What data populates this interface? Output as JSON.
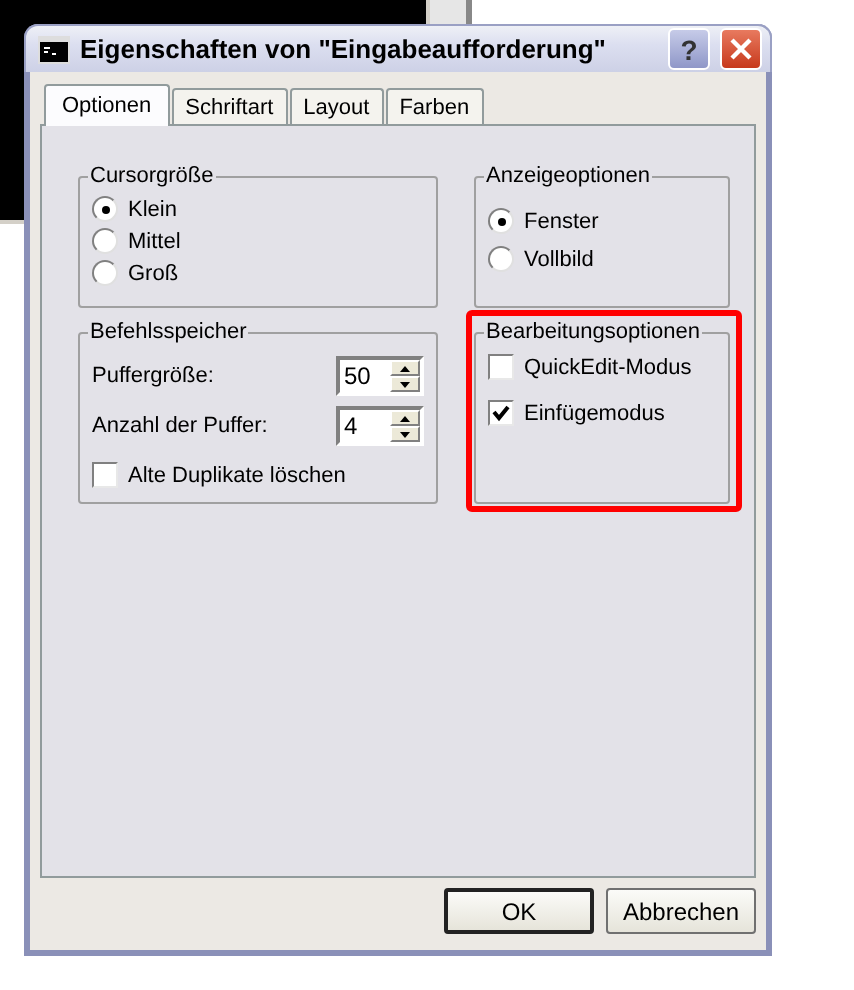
{
  "window": {
    "title": "Eigenschaften von \"Eingabeaufforderung\"",
    "help_button": "?"
  },
  "tabs": [
    {
      "label": "Optionen",
      "selected": true
    },
    {
      "label": "Schriftart",
      "selected": false
    },
    {
      "label": "Layout",
      "selected": false
    },
    {
      "label": "Farben",
      "selected": false
    }
  ],
  "cursor_size": {
    "title": "Cursorgröße",
    "options": [
      {
        "label": "Klein",
        "selected": true
      },
      {
        "label": "Mittel",
        "selected": false
      },
      {
        "label": "Groß",
        "selected": false
      }
    ]
  },
  "display_options": {
    "title": "Anzeigeoptionen",
    "options": [
      {
        "label": "Fenster",
        "selected": true
      },
      {
        "label": "Vollbild",
        "selected": false
      }
    ]
  },
  "command_history": {
    "title": "Befehlsspeicher",
    "spinners": [
      {
        "label": "Puffergröße:",
        "value": "50"
      },
      {
        "label": "Anzahl der Puffer:",
        "value": "4"
      }
    ],
    "checkbox": {
      "label": "Alte Duplikate löschen",
      "checked": false
    }
  },
  "edit_options": {
    "title": "Bearbeitungsoptionen",
    "highlighted": true,
    "checkboxes": [
      {
        "label": "QuickEdit-Modus",
        "checked": false
      },
      {
        "label": "Einfügemodus",
        "checked": true
      }
    ]
  },
  "buttons": [
    {
      "label": "OK",
      "default": true
    },
    {
      "label": "Abbrechen",
      "default": false
    }
  ]
}
